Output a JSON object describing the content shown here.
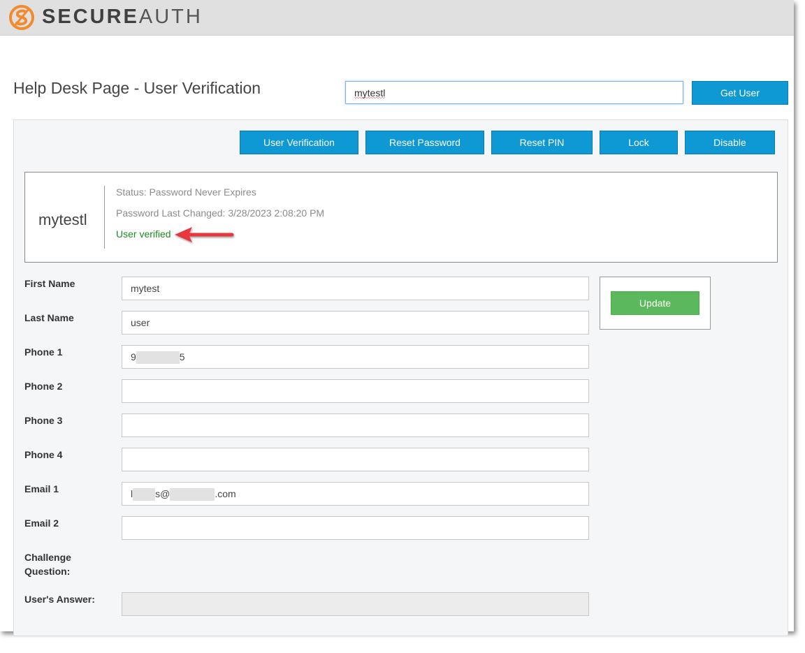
{
  "brand": {
    "name_bold": "SECURE",
    "name_light": "AUTH",
    "accent_color": "#f28a2e"
  },
  "header": {
    "title": "Help Desk Page - User Verification"
  },
  "search": {
    "value": "mytestl",
    "button_label": "Get User"
  },
  "actions": [
    {
      "label": "User Verification"
    },
    {
      "label": "Reset Password"
    },
    {
      "label": "Reset PIN"
    },
    {
      "label": "Lock"
    },
    {
      "label": "Disable"
    }
  ],
  "user_card": {
    "username": "mytestl",
    "status": "Status: Password Never Expires",
    "password_last_changed": "Password Last Changed: 3/28/2023 2:08:20 PM",
    "verification": "User verified",
    "verification_color": "#1e8a1e"
  },
  "form": {
    "first_name": {
      "label": "First Name",
      "value": "mytest"
    },
    "last_name": {
      "label": "Last Name",
      "value": "user"
    },
    "phone1": {
      "label": "Phone 1",
      "value_prefix": "9",
      "value_suffix": "5"
    },
    "phone2": {
      "label": "Phone 2",
      "value": ""
    },
    "phone3": {
      "label": "Phone 3",
      "value": ""
    },
    "phone4": {
      "label": "Phone 4",
      "value": ""
    },
    "email1": {
      "label": "Email 1",
      "value_prefix": "l",
      "value_mid": "s@",
      "value_suffix": ".com"
    },
    "email2": {
      "label": "Email 2",
      "value": ""
    },
    "challenge_question": {
      "label_line1": "Challenge",
      "label_line2": "Question:"
    },
    "users_answer": {
      "label": "User's Answer:",
      "value": ""
    },
    "update_label": "Update"
  }
}
